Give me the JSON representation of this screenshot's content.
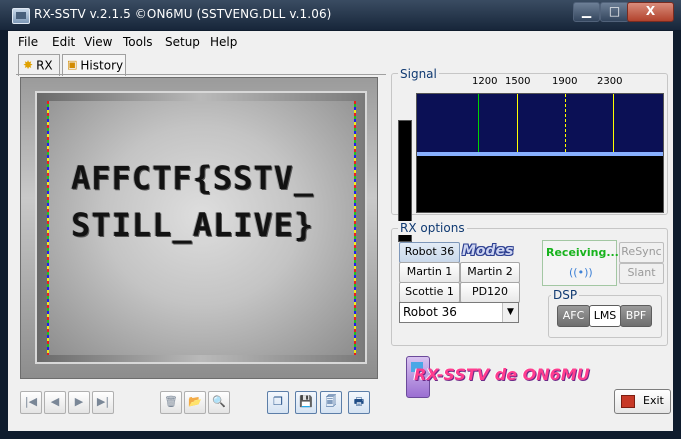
{
  "window": {
    "title": "RX-SSTV v.2.1.5 ©ON6MU (SSTVENG.DLL v.1.06)",
    "min_symbol": "▁",
    "max_symbol": "□",
    "close_symbol": "X"
  },
  "menu": [
    "File",
    "Edit",
    "View",
    "Tools",
    "Setup",
    "Help"
  ],
  "tabs": {
    "rx": "RX",
    "history": "History"
  },
  "image": {
    "line1": "AFFCTF{SSTV_",
    "line2": "STILL_ALIVE}"
  },
  "toolbar": {
    "first": "|◀",
    "prev": "◀",
    "next": "▶",
    "last": "▶|",
    "trash": "🗑",
    "open": "📂",
    "zoom": "🔍",
    "copy": "❐",
    "save": "💾",
    "save_all": "🗐",
    "print": "🖶"
  },
  "signal": {
    "label": "Signal",
    "freq_labels": [
      "1200",
      "1500",
      "1900",
      "2300"
    ]
  },
  "rx_options": {
    "label": "RX options",
    "modes_logo": "Modes",
    "buttons": [
      "Robot 36",
      "Martin 1",
      "Martin 2",
      "Scottie 1",
      "PD120"
    ],
    "selected_mode": "Robot 36",
    "combo_value": "Robot 36",
    "status": "Receiving...",
    "resync": "ReSync",
    "slant": "Slant"
  },
  "dsp": {
    "label": "DSP",
    "afc": "AFC",
    "lms": "LMS",
    "bpf": "BPF"
  },
  "brand": {
    "logo_text": "RX-SSTV de ON6MU"
  },
  "exit": {
    "label": "Exit"
  },
  "colors": {
    "receiving": "#17b31c",
    "spectrum_bg": "#0b1055",
    "green_marker": "#00d200",
    "yellow_marker": "#ffff00"
  }
}
